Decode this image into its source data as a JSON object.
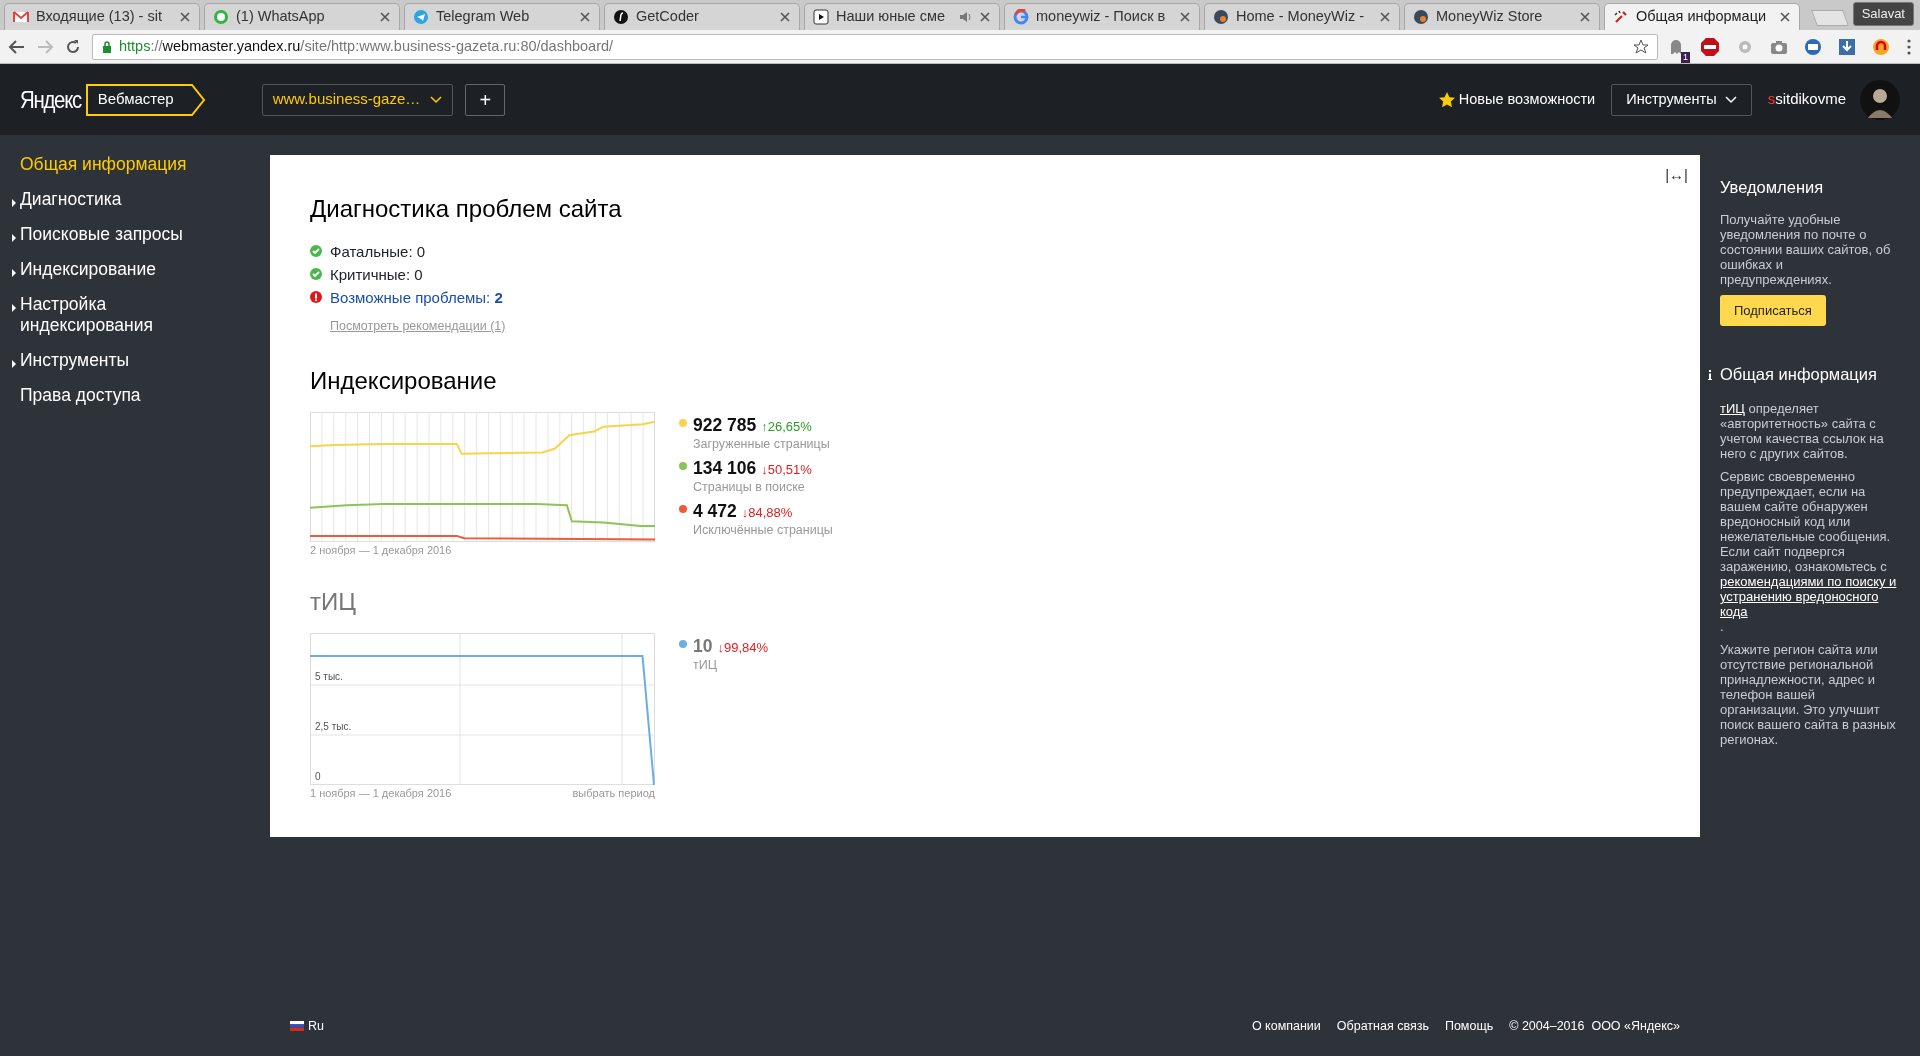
{
  "browser": {
    "tabs": [
      {
        "title": "Входящие (13) - sit",
        "kind": "mail",
        "selected": false,
        "audio": false
      },
      {
        "title": "(1) WhatsApp",
        "kind": "chat",
        "selected": false,
        "audio": false
      },
      {
        "title": "Telegram Web",
        "kind": "plane",
        "selected": false,
        "audio": false
      },
      {
        "title": "GetCoder",
        "kind": "coder",
        "selected": false,
        "audio": false
      },
      {
        "title": "Наши юные сме",
        "kind": "video",
        "selected": false,
        "audio": true
      },
      {
        "title": "moneywiz - Поиск в",
        "kind": "search",
        "selected": false,
        "audio": false
      },
      {
        "title": "Home - MoneyWiz -",
        "kind": "globe",
        "selected": false,
        "audio": false
      },
      {
        "title": "MoneyWiz Store",
        "kind": "globe",
        "selected": false,
        "audio": false
      },
      {
        "title": "Общая информаци",
        "kind": "tools",
        "selected": true,
        "audio": false
      }
    ],
    "profile": "Salavat",
    "address": {
      "scheme": "https",
      "separator": "://",
      "host": "webmaster.yandex.ru",
      "path": "/site/http:www.business-gazeta.ru:80/dashboard/"
    },
    "extension_badge": "1"
  },
  "header": {
    "logo": "Яндекс",
    "service": "Вебмастер",
    "site": "www.business-gaze…",
    "add": "+",
    "whats_new": "Новые возможности",
    "tools": "Инструменты",
    "login": "ssitdikovme"
  },
  "sidebar": {
    "items": [
      {
        "label": "Общая информация",
        "selected": true,
        "expandable": false
      },
      {
        "label": "Диагностика",
        "selected": false,
        "expandable": true
      },
      {
        "label": "Поисковые запросы",
        "selected": false,
        "expandable": true
      },
      {
        "label": "Индексирование",
        "selected": false,
        "expandable": true
      },
      {
        "label": "Настройка индексирования",
        "selected": false,
        "expandable": true
      },
      {
        "label": "Инструменты",
        "selected": false,
        "expandable": true
      },
      {
        "label": "Права доступа",
        "selected": false,
        "expandable": false
      }
    ]
  },
  "diagnostics": {
    "title": "Диагностика проблем сайта",
    "items": [
      {
        "kind": "ok",
        "text": "Фатальные: 0"
      },
      {
        "kind": "ok",
        "text": "Критичные: 0"
      },
      {
        "kind": "warning",
        "text": "Возможные проблемы: **2**"
      }
    ],
    "recommendations": "Посмотреть рекомендации (1)"
  },
  "indexing": {
    "title": "Индексирование",
    "period": "2 ноября — 1 декабря 2016",
    "legend": [
      {
        "value": "922 785",
        "change": {
          "text": "↑26,65%",
          "color": "#2a9a2a"
        },
        "label": "Загруженные страницы",
        "color": "#f6d44c"
      },
      {
        "value": "134 106",
        "change": {
          "text": "↓50,51%",
          "color": "#e02020"
        },
        "label": "Страницы в поиске",
        "color": "#8dc45a"
      },
      {
        "value": "4 472",
        "change": {
          "text": "↓84,88%",
          "color": "#e02020"
        },
        "label": "Исключённые страницы",
        "color": "#ee5a3c"
      }
    ]
  },
  "tic": {
    "title": "тИЦ",
    "period": "1 ноября — 1 декабря 2016",
    "choose_period": "выбрать период",
    "legend": {
      "value": "10",
      "change": {
        "text": "↓99,84%",
        "color": "#e02020"
      },
      "label": "тИЦ",
      "color": "#6aaee3"
    },
    "chart_data": {
      "type": "line",
      "grid": true,
      "ylim": [
        0,
        7.6
      ],
      "yticks": [
        {
          "value": 0,
          "label": "0"
        },
        {
          "value": 2.5,
          "label": "2,5 тыс."
        },
        {
          "value": 5,
          "label": "5 тыс."
        }
      ],
      "series": [
        {
          "color": "#6aaee3",
          "values": [
            6.45,
            6.45,
            6.45,
            6.45,
            6.45,
            6.45,
            6.45,
            6.45,
            6.45,
            6.45,
            6.45,
            6.45,
            6.45,
            6.45,
            6.45,
            6.45,
            6.45,
            6.45,
            6.45,
            6.45,
            6.45,
            6.45,
            6.45,
            6.45,
            6.45,
            6.45,
            6.45,
            6.45,
            6.45,
            6.45,
            0.01
          ]
        }
      ]
    }
  },
  "expand": "|↔|",
  "aside": {
    "notifications": {
      "title": "Уведомления",
      "text": "Получайте удобные уведомления по почте о состоянии ваших сайтов, об ошибках и предупреждениях.",
      "button": "Подписаться"
    },
    "info": {
      "title": "Общая информация",
      "paragraphs": [
        [
          {
            "text": "тИЦ",
            "link": true
          },
          {
            "text": " определяет «авторитетность» сайта с учетом качества ссылок на него с других сайтов.",
            "link": false
          }
        ],
        [
          {
            "text": "Сервис своевременно предупреждает, если на вашем сайте обнаружен вредоносный код или нежелательные сообщения. Если сайт подвергся заражению, ознакомьтесь с ",
            "link": false
          },
          {
            "text": "рекомендациями по поиску и устранению вредоносного кода",
            "link": true
          },
          {
            "text": ".",
            "link": false
          }
        ],
        [
          {
            "text": "Укажите регион сайта или отсутствие региональной принадлежности, адрес и телефон вашей организации. Это улучшит поиск вашего сайта в разных регионах.",
            "link": false
          }
        ]
      ]
    }
  },
  "footer": {
    "language": "Ru",
    "links": [
      "О компании",
      "Обратная связь",
      "Помощь"
    ],
    "copyright": "© 2004–2016  ООО «Яндекс»"
  }
}
